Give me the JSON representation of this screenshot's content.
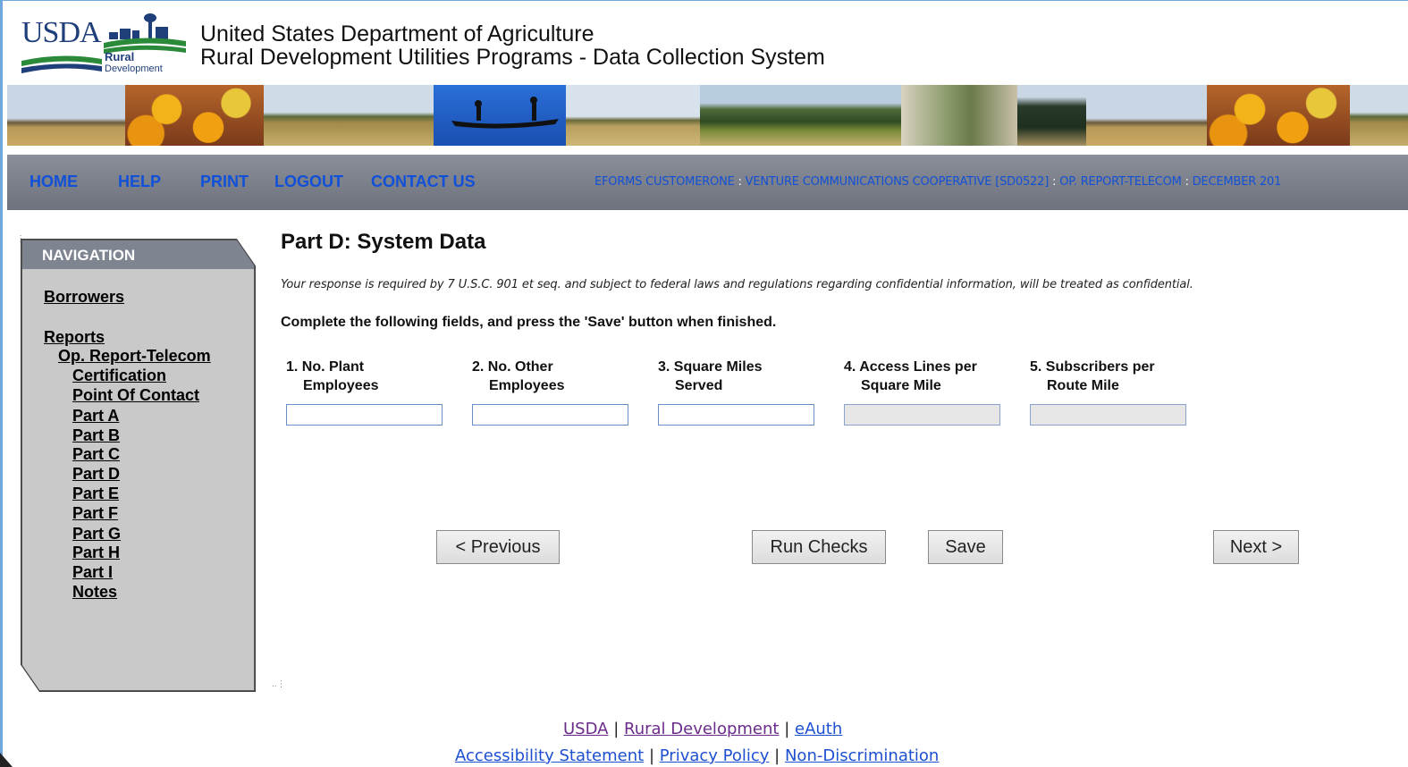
{
  "header": {
    "logo_text": "USDA",
    "logo_rural": "Rural",
    "logo_development": "Development",
    "title_line1": "United States Department of Agriculture",
    "title_line2": "Rural Development Utilities Programs - Data Collection System"
  },
  "navbar": {
    "links": [
      "HOME",
      "HELP",
      "PRINT",
      "LOGOUT",
      "CONTACT US"
    ],
    "crumb": {
      "user": "EFORMS CUSTOMERONE",
      "org": "VENTURE COMMUNICATIONS COOPERATIVE [SD0522]",
      "report": "OP. REPORT-TELECOM",
      "period": "DECEMBER 201"
    },
    "separator": ":"
  },
  "navigation": {
    "heading": "NAVIGATION",
    "borrowers": "Borrowers",
    "reports": "Reports",
    "report_name": "Op. Report-Telecom",
    "items": [
      "Certification",
      "Point Of Contact",
      "Part A",
      "Part B",
      "Part C",
      "Part D",
      "Part E",
      "Part F",
      "Part G",
      "Part H",
      "Part I",
      "Notes"
    ]
  },
  "main": {
    "title": "Part D: System Data",
    "notice": "Your response is required by 7 U.S.C. 901 et seq. and subject to federal laws and regulations regarding confidential information, will be treated as confidential.",
    "instructions": "Complete the following fields, and press the 'Save' button when finished.",
    "fields": [
      {
        "line1": "1. No. Plant",
        "line2": "Employees",
        "value": "",
        "readonly": false
      },
      {
        "line1": "2. No. Other",
        "line2": "Employees",
        "value": "",
        "readonly": false
      },
      {
        "line1": "3. Square Miles",
        "line2": "Served",
        "value": "",
        "readonly": false
      },
      {
        "line1": "4. Access Lines per",
        "line2": "Square Mile",
        "value": "",
        "readonly": true
      },
      {
        "line1": "5. Subscribers per",
        "line2": "Route Mile",
        "value": "",
        "readonly": true
      }
    ],
    "buttons": {
      "previous": "< Previous",
      "run_checks": "Run Checks",
      "save": "Save",
      "next": "Next >"
    }
  },
  "footer": {
    "line1": [
      "USDA",
      "Rural Development",
      "eAuth"
    ],
    "line2": [
      "Accessibility Statement",
      "Privacy Policy",
      "Non-Discrimination"
    ],
    "separator": "|"
  },
  "colors": {
    "nav_link": "#1150d8",
    "navbar_bg": "#7a7f89",
    "panel_bg": "#c9c9c9",
    "panel_head": "#7f8590"
  }
}
